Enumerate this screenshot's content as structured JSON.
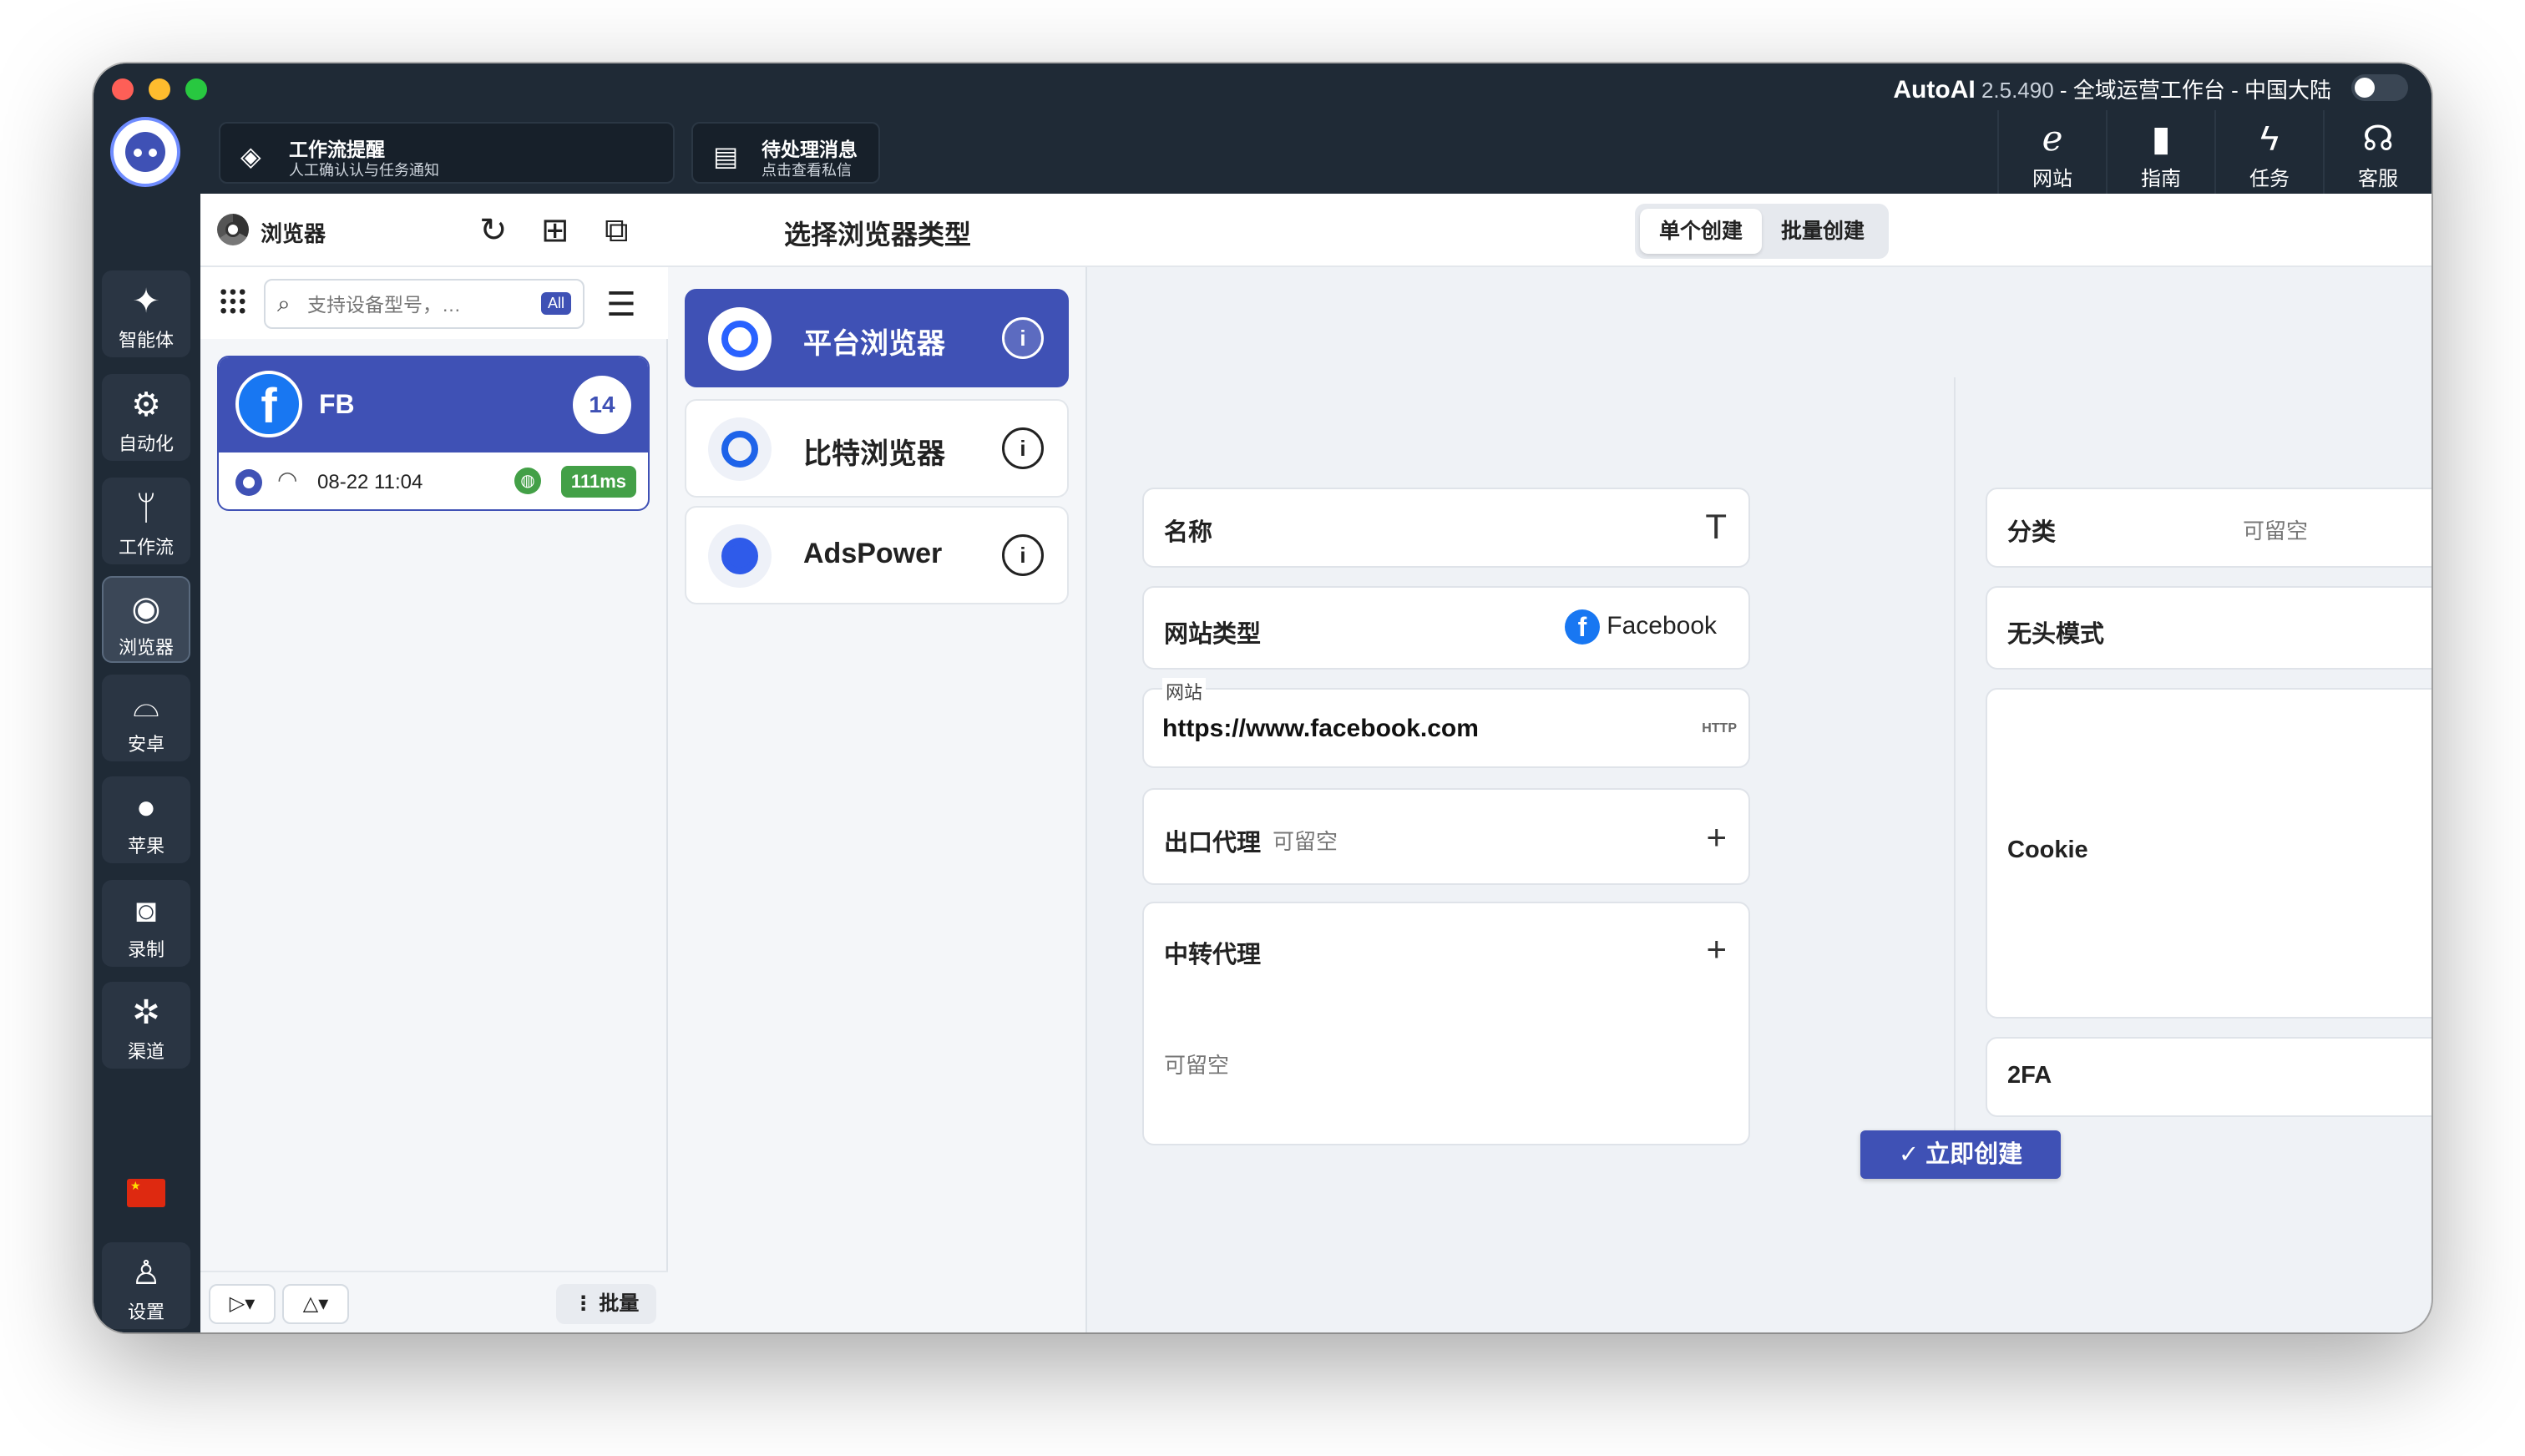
{
  "window": {
    "app_name": "AutoAI",
    "version": "2.5.490",
    "separator1": "-",
    "workspace": "全域运营工作台",
    "separator2": "-",
    "region": "中国大陆"
  },
  "header": {
    "cards": [
      {
        "icon": "handshake-icon",
        "title": "工作流提醒",
        "subtitle": "人工确认认与任务通知"
      },
      {
        "icon": "chat-icon",
        "title": "待处理消息",
        "subtitle": "点击查看私信"
      }
    ],
    "buttons": [
      {
        "icon": "ie-icon",
        "label": "网站"
      },
      {
        "icon": "book-icon",
        "label": "指南"
      },
      {
        "icon": "bolt-icon",
        "label": "任务"
      },
      {
        "icon": "headset-icon",
        "label": "客服"
      }
    ]
  },
  "rail": {
    "items": [
      {
        "icon": "sparkle-icon",
        "label": "智能体"
      },
      {
        "icon": "gear-icon",
        "label": "自动化"
      },
      {
        "icon": "branch-icon",
        "label": "工作流"
      },
      {
        "icon": "chrome-icon",
        "label": "浏览器"
      },
      {
        "icon": "android-icon",
        "label": "安卓"
      },
      {
        "icon": "apple-icon",
        "label": "苹果"
      },
      {
        "icon": "camera-icon",
        "label": "录制"
      },
      {
        "icon": "network-icon",
        "label": "渠道"
      }
    ],
    "settings_label": "设置"
  },
  "list_panel": {
    "title": "浏览器",
    "search_placeholder": "支持设备型号，…",
    "filter_badge": "All",
    "device": {
      "name": "FB",
      "count": "14",
      "time": "08-22 11:04",
      "latency": "111ms"
    },
    "batch_label": "⋮ 批量"
  },
  "type_panel": {
    "title": "选择浏览器类型",
    "types": [
      {
        "label": "平台浏览器",
        "active": true
      },
      {
        "label": "比特浏览器",
        "active": false
      },
      {
        "label": "AdsPower",
        "active": false
      }
    ]
  },
  "form": {
    "tabs": [
      "单个创建",
      "批量创建"
    ],
    "active_tab": 0,
    "name_label": "名称",
    "site_type_label": "网站类型",
    "site_type_value": "Facebook",
    "site_label": "网站",
    "site_value": "https://www.facebook.com",
    "site_badge": "HTTP",
    "exit_proxy_label": "出口代理",
    "exit_proxy_hint": "可留空",
    "relay_proxy_label": "中转代理",
    "relay_proxy_hint": "可留空",
    "category_label": "分类",
    "category_hint": "可留空",
    "headless_label": "无头模式",
    "headless_on": false,
    "cookie_label": "Cookie",
    "twofa_label": "2FA",
    "submit_label": "立即创建"
  },
  "colors": {
    "accent": "#3f51b5",
    "sidebar": "#1f2a36",
    "success": "#43a047",
    "facebook": "#1877f2"
  }
}
